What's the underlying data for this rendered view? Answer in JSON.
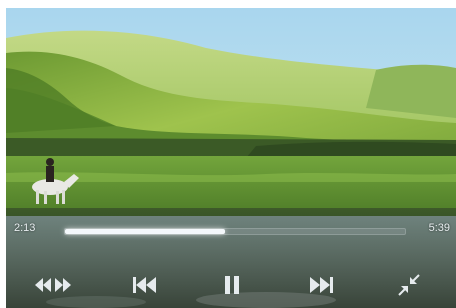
{
  "player": {
    "time_current": "2:13",
    "time_total": "5:39",
    "progress_fraction": 0.47
  },
  "icons": {
    "seek": "rewind-fast-forward-icon",
    "prev": "skip-previous-icon",
    "pause": "pause-icon",
    "next": "skip-next-icon",
    "exit_fullscreen": "exit-fullscreen-icon"
  },
  "colors": {
    "progress_fill": "#f4f8fb",
    "controls": "#e6ebee"
  }
}
